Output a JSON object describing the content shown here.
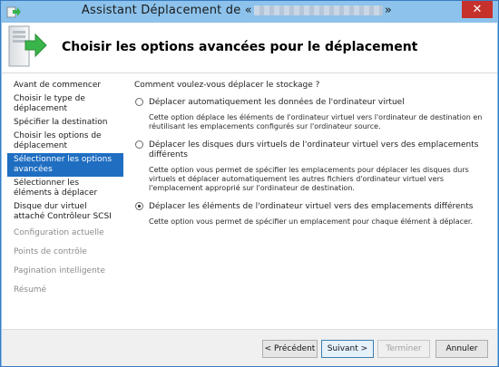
{
  "window": {
    "title_prefix": "Assistant Déplacement de «",
    "title_suffix": "»",
    "close_label": "✕",
    "icon": "wizard-app-icon"
  },
  "header": {
    "heading": "Choisir les options avancées pour le déplacement",
    "icon": "server-arrow-icon"
  },
  "sidebar": {
    "steps": [
      {
        "label": "Avant de commencer"
      },
      {
        "label": "Choisir le type de déplacement"
      },
      {
        "label": "Spécifier la destination"
      },
      {
        "label": "Choisir les options de déplacement"
      },
      {
        "label": "Sélectionner les options avancées"
      },
      {
        "label": "Sélectionner les éléments à déplacer"
      },
      {
        "label": "Disque dur virtuel attaché Contrôleur SCSI"
      },
      {
        "label": "Configuration actuelle"
      },
      {
        "label": "Points de contrôle"
      },
      {
        "label": "Pagination intelligente"
      },
      {
        "label": "Résumé"
      }
    ]
  },
  "main": {
    "question": "Comment voulez-vous déplacer le stockage ?",
    "options": [
      {
        "label": "Déplacer automatiquement les données de l'ordinateur virtuel",
        "description": "Cette option déplace les éléments de l'ordinateur virtuel vers l'ordinateur de destination en réutilisant les emplacements configurés sur l'ordinateur source.",
        "selected": false
      },
      {
        "label": "Déplacer les disques durs virtuels de l'ordinateur virtuel vers des emplacements différents",
        "description": "Cette option vous permet de spécifier les emplacements pour déplacer les disques durs virtuels et déplacer automatiquement les autres fichiers d'ordinateur virtuel vers l'emplacement approprié sur l'ordinateur de destination.",
        "selected": false
      },
      {
        "label": "Déplacer les éléments de l'ordinateur virtuel vers des emplacements différents",
        "description": "Cette option vous permet de spécifier un emplacement pour chaque élément à déplacer.",
        "selected": true
      }
    ]
  },
  "footer": {
    "prev_label": "< Précédent",
    "next_label": "Suivant >",
    "finish_label": "Terminer",
    "cancel_label": "Annuler"
  },
  "colors": {
    "titlebar": "#8cc2eb",
    "selection": "#1f6ec2",
    "close": "#c7312c"
  }
}
